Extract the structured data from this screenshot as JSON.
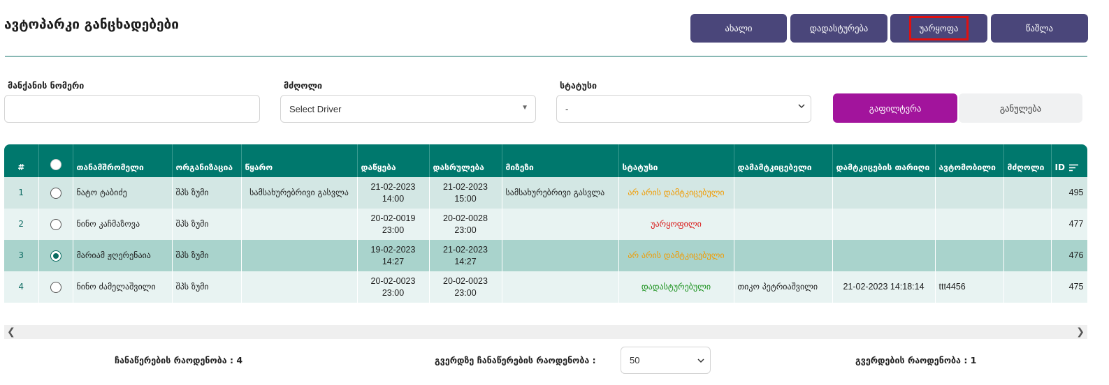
{
  "header": {
    "title": "ავტოპარკი განცხადებები",
    "buttons": {
      "new": "ახალი",
      "approve": "დადასტურება",
      "reject": "უარყოფა",
      "delete": "წაშლა"
    }
  },
  "filters": {
    "car_number": {
      "label": "მანქანის ნომერი",
      "value": ""
    },
    "driver": {
      "label": "მძღოლი",
      "value": "Select Driver"
    },
    "status": {
      "label": "სტატუსი",
      "value": "-"
    },
    "filter_button": "გაფილტვრა",
    "reset_button": "განულება"
  },
  "colors": {
    "header_teal": "#00786d",
    "button_purple": "#4a467a",
    "filter_magenta": "#a2149c",
    "status_pending": "#f19b00",
    "status_rejected": "#d81616",
    "status_approved": "#179019"
  },
  "table": {
    "columns": {
      "num": "#",
      "employee": "თანამშრომელი",
      "organization": "ორგანიზაცია",
      "source": "წყარო",
      "start": "დაწყება",
      "end": "დასრულება",
      "reason": "მიზეზი",
      "status": "სტატუსი",
      "approver": "დამამტკიცებელი",
      "approval_date": "დამტკიცების თარიღი",
      "car": "ავტომობილი",
      "driver": "მძღოლი",
      "id": "ID"
    },
    "rows": [
      {
        "num": "1",
        "selected": false,
        "employee": "ნატო ტაბიძე",
        "organization": "შპს ზუმი",
        "source": "სამსახურებრივი გასვლა",
        "start_date": "21-02-2023",
        "start_time": "14:00",
        "end_date": "21-02-2023",
        "end_time": "15:00",
        "reason": "სამსახურებრივი გასვლა",
        "status": "არ არის დამტკიცებული",
        "approver": "",
        "approval_date": "",
        "car": "",
        "driver": "",
        "id": "495"
      },
      {
        "num": "2",
        "selected": false,
        "employee": "ნინო კაჩმაზოვა",
        "organization": "შპს ზუმი",
        "source": "",
        "start_date": "20-02-0019",
        "start_time": "23:00",
        "end_date": "20-02-0028",
        "end_time": "23:00",
        "reason": "",
        "status": "უარყოფილი",
        "approver": "",
        "approval_date": "",
        "car": "",
        "driver": "",
        "id": "477"
      },
      {
        "num": "3",
        "selected": true,
        "employee": "მარიამ ჟღერენაია",
        "organization": "შპს ზუმი",
        "source": "",
        "start_date": "19-02-2023",
        "start_time": "14:27",
        "end_date": "21-02-2023",
        "end_time": "14:27",
        "reason": "",
        "status": "არ არის დამტკიცებული",
        "approver": "",
        "approval_date": "",
        "car": "",
        "driver": "",
        "id": "476"
      },
      {
        "num": "4",
        "selected": false,
        "employee": "ნინო ძამელაშვილი",
        "organization": "შპს ზუმი",
        "source": "",
        "start_date": "20-02-0023",
        "start_time": "23:00",
        "end_date": "20-02-0023",
        "end_time": "23:00",
        "reason": "",
        "status": "დადასტურებული",
        "approver": "თიკო პეტრიაშვილი",
        "approval_date": "21-02-2023 14:18:14",
        "car": "ttt4456",
        "driver": "",
        "id": "475"
      }
    ]
  },
  "footer": {
    "records_count": "ჩანაწერების რაოდენობა : 4",
    "per_page_label": "გვერდზე ჩანაწერების რაოდენობა :",
    "per_page_value": "50",
    "pages_count": "გვერდების რაოდენობა : 1"
  }
}
